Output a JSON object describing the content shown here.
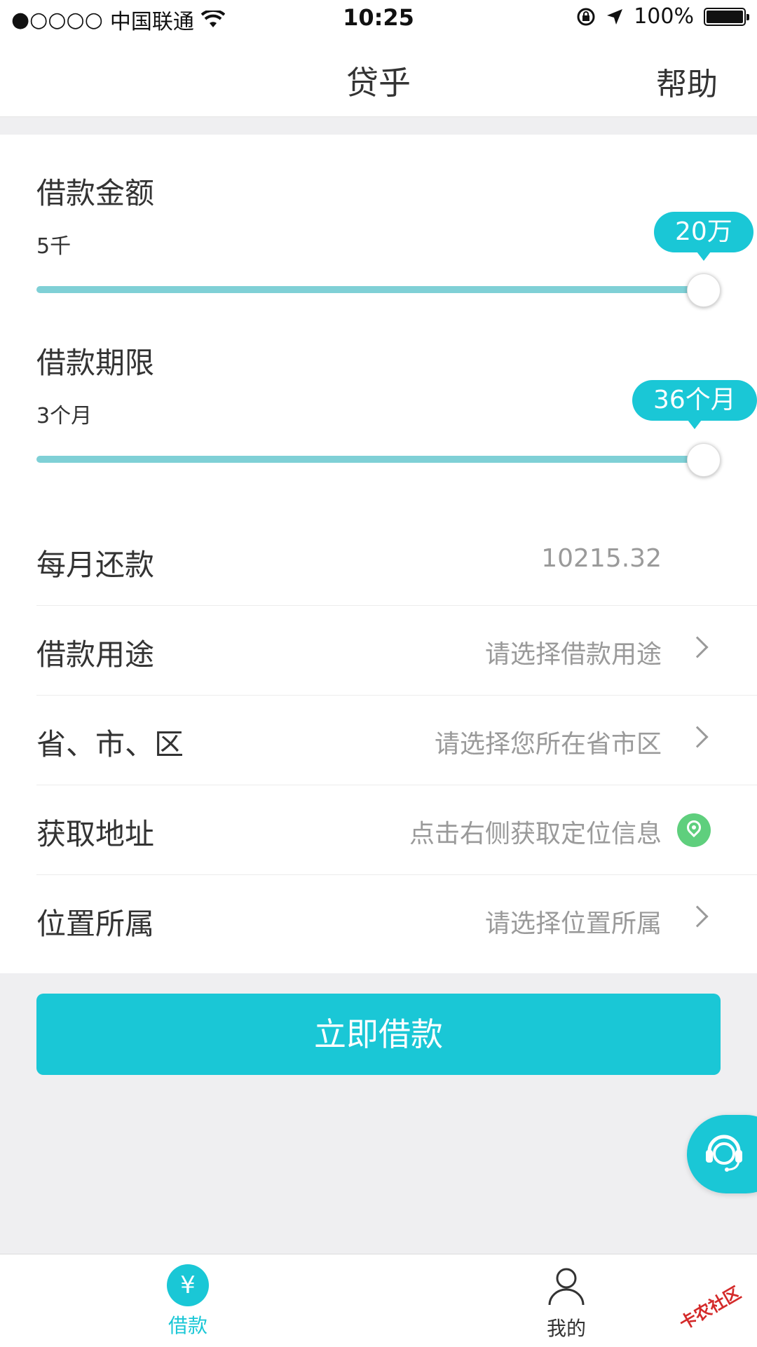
{
  "status_bar": {
    "signal": "●○○○○",
    "carrier": "中国联通",
    "time": "10:25",
    "battery": "100%"
  },
  "nav": {
    "title": "贷乎",
    "help": "帮助"
  },
  "loan_amount": {
    "title": "借款金额",
    "min_label": "5千",
    "value_label": "20万",
    "slider_fraction": 1.0
  },
  "loan_term": {
    "title": "借款期限",
    "min_label": "3个月",
    "value_label": "36个月",
    "slider_fraction": 1.0
  },
  "rows": {
    "monthly": {
      "label": "每月还款",
      "value": "10215.32"
    },
    "purpose": {
      "label": "借款用途",
      "value": "请选择借款用途"
    },
    "region": {
      "label": "省、市、区",
      "value": "请选择您所在省市区"
    },
    "address": {
      "label": "获取地址",
      "value": "点击右侧获取定位信息"
    },
    "location": {
      "label": "位置所属",
      "value": "请选择位置所属"
    }
  },
  "submit_label": "立即借款",
  "tabs": {
    "loan": {
      "label": "借款",
      "icon": "yen-icon",
      "symbol": "¥"
    },
    "mine": {
      "label": "我的",
      "icon": "user-icon"
    }
  },
  "watermark": "卡农社区",
  "colors": {
    "accent": "#1ac7d6",
    "track": "#7fd0d6",
    "location_green": "#5fcf7d"
  }
}
